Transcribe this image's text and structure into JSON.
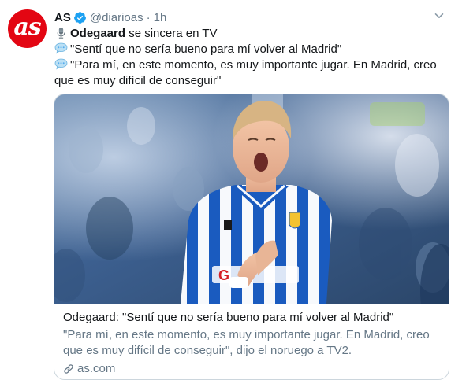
{
  "tweet": {
    "avatar_text": "as",
    "author_name": "AS",
    "handle": "@diarioas",
    "separator": "·",
    "time": "1h",
    "lines": {
      "headline_bold": "Odegaard",
      "headline_rest": " se sincera en TV",
      "quote1": "\"Sentí que no sería bueno para mí volver al Madrid\"",
      "quote2": "\"Para mí, en este momento, es muy importante jugar. En Madrid, creo que es muy difícil de conseguir\""
    },
    "icons": {
      "headline": "microphone-icon",
      "quotes": "speech-balloon-icon",
      "verified": "verified-badge-icon",
      "menu": "chevron-down-icon",
      "link": "link-icon"
    }
  },
  "card": {
    "image_description_kind": "photo",
    "title": "Odegaard: \"Sentí que no sería bueno para mí volver al Madrid\"",
    "description": "\"Para mí, en este momento, es muy importante jugar. En Madrid, creo que es muy difícil de conseguir\", dijo el noruego a TV2.",
    "domain": "as.com"
  },
  "colors": {
    "brand_red": "#e30613",
    "verified_blue": "#1da1f2",
    "secondary_text": "#657786",
    "border": "#ccd6dd",
    "jersey_blue": "#1a5bbf"
  }
}
